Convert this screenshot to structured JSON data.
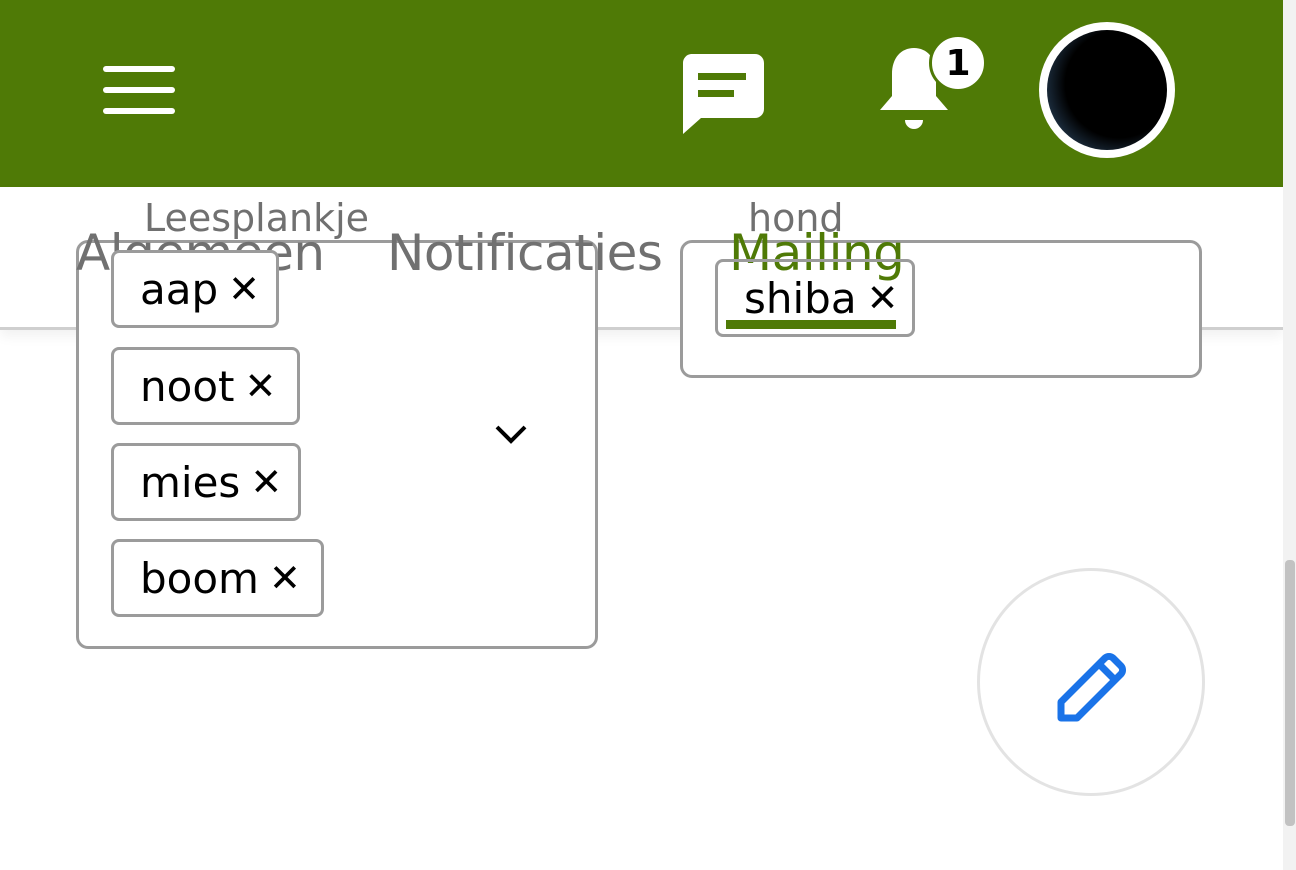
{
  "header": {
    "menu_icon": "hamburger-icon",
    "chat_icon": "chat-bubble-icon",
    "bell_icon": "bell-icon",
    "notification_count": "1",
    "avatar_icon": "user-avatar",
    "bar_color": "#4f7a06"
  },
  "tabs": [
    {
      "label": "Algemeen",
      "active": false
    },
    {
      "label": "Notificaties",
      "active": false
    },
    {
      "label": "Mailing",
      "active": true
    }
  ],
  "fields": {
    "leesplankje": {
      "label": "Leesplankje",
      "chips": [
        "aap",
        "noot",
        "mies",
        "boom"
      ],
      "remove_glyph": "✕",
      "dropdown_icon": "chevron-down-icon"
    },
    "hond": {
      "label": "hond",
      "chips": [
        "shiba"
      ],
      "remove_glyph": "✕"
    }
  },
  "fab": {
    "icon": "pencil-icon",
    "color": "#1a73e8"
  }
}
